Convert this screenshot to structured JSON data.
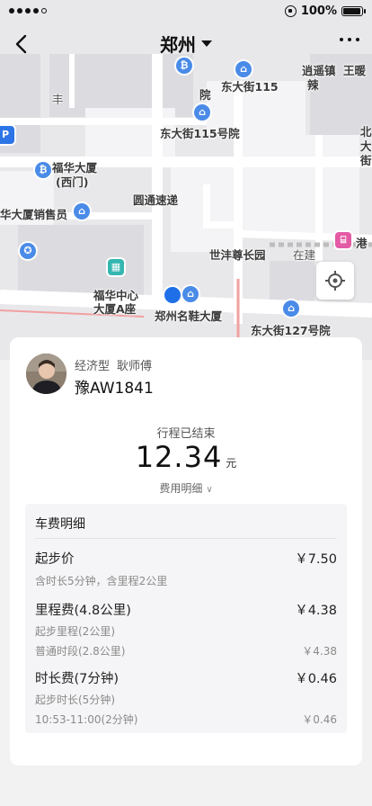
{
  "status_bar": {
    "battery": "100%",
    "battery_level": 1.0
  },
  "nav": {
    "city": "郑州"
  },
  "map": {
    "labels": [
      "丰",
      "院",
      "东大街115",
      "逍遥镇",
      "王暖",
      "东大街115号院",
      "福华大厦",
      "(西门)",
      "圆通速递",
      "华大厦销售员",
      "世沣尊长园",
      "在建",
      "港",
      "福华中心",
      "大厦A座",
      "郑州名鞋大厦",
      "东大街127号院",
      "北",
      "大",
      "街",
      "辣"
    ]
  },
  "driver": {
    "car_type": "经济型",
    "name": "耿师傅",
    "plate": "豫AW1841"
  },
  "trip": {
    "status": "行程已结束",
    "amount": "12.34",
    "unit": "元",
    "detail_link": "费用明细"
  },
  "breakdown": {
    "title": "车费明细",
    "items": [
      {
        "label": "起步价",
        "value": "￥7.50"
      },
      {
        "label": "含时长5分钟，含里程2公里",
        "value": ""
      },
      {
        "label": "里程费(4.8公里)",
        "value": "￥4.38"
      },
      {
        "label": "起步里程(2公里)",
        "value": ""
      },
      {
        "label": "普通时段(2.8公里)",
        "value": "￥4.38"
      },
      {
        "label": "时长费(7分钟)",
        "value": "￥0.46"
      },
      {
        "label": "起步时长(5分钟)",
        "value": ""
      },
      {
        "label": "10:53-11:00(2分钟)",
        "value": "￥0.46"
      }
    ]
  }
}
